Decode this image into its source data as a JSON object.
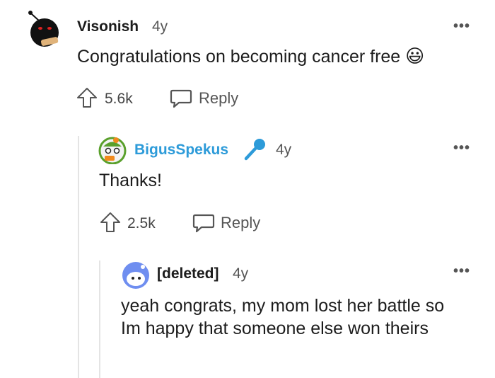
{
  "comments": [
    {
      "username": "Visonish",
      "age": "4y",
      "body": "Congratulations on becoming cancer free",
      "emoji": "😃",
      "votes": "5.6k",
      "reply_label": "Reply",
      "more_label": "•••"
    },
    {
      "username": "BigusSpekus",
      "age": "4y",
      "body": "Thanks!",
      "votes": "2.5k",
      "reply_label": "Reply",
      "more_label": "•••",
      "op_color": "#2d9bd9"
    },
    {
      "username": "[deleted]",
      "age": "4y",
      "body": "yeah congrats, my mom lost her battle so Im happy that someone else won theirs",
      "more_label": "•••"
    }
  ]
}
